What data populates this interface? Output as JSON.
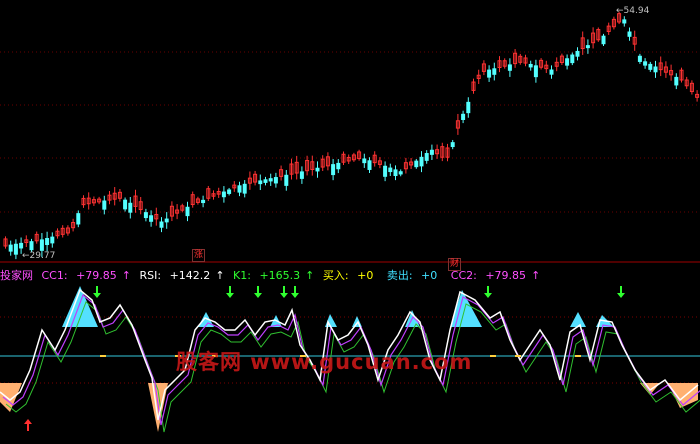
{
  "window": {
    "background": "#000000"
  },
  "price_panel": {
    "high_label": "54.94",
    "low_label": "29.77",
    "markers": [
      {
        "text": "涨",
        "kind": "event-marker"
      },
      {
        "text": "财",
        "kind": "event-marker"
      }
    ],
    "colors": {
      "up": "#ff3232",
      "down": "#54ffff"
    }
  },
  "indicator_panel": {
    "name": "投家网",
    "fields": [
      {
        "label": "CC1:",
        "value": "+79.85",
        "color": "#ff50ff"
      },
      {
        "label": "RSI:",
        "value": "+142.2",
        "color": "#ffffff"
      },
      {
        "label": "K1:",
        "value": "+165.3",
        "color": "#30ff30"
      },
      {
        "label": "买入:",
        "value": "+0",
        "color": "#ffff00"
      },
      {
        "label": "卖出:",
        "value": "+0",
        "color": "#40e0ff"
      },
      {
        "label": "CC2:",
        "value": "+79.85",
        "color": "#ff50ff"
      }
    ]
  },
  "watermark": "股客网 www.gucuan.com"
}
